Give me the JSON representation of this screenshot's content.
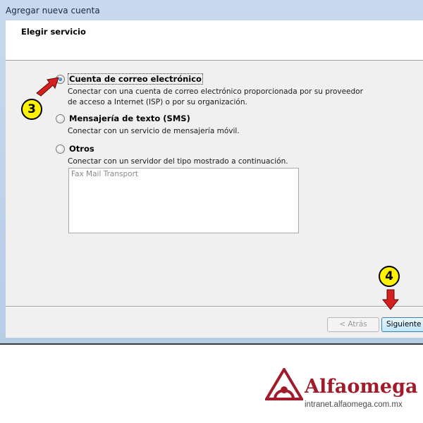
{
  "window": {
    "title": "Agregar nueva cuenta"
  },
  "header": {
    "title": "Elegir servicio"
  },
  "options": [
    {
      "label": "Cuenta de correo electrónico",
      "selected": true,
      "description": [
        "Conectar con una cuenta de correo electrónico proporcionada por su proveedor",
        "de acceso a Internet (ISP) o por su organización."
      ]
    },
    {
      "label": "Mensajería de texto (SMS)",
      "selected": false,
      "description": [
        "Conectar con un servicio de mensajería móvil."
      ]
    },
    {
      "label": "Otros",
      "selected": false,
      "description": [
        "Conectar con un servidor del tipo mostrado a continuación."
      ]
    }
  ],
  "server_list": {
    "items": [
      "Fax Mail Transport"
    ]
  },
  "buttons": {
    "back": "< Atrás",
    "next": "Siguiente >"
  },
  "callouts": [
    "3",
    "4"
  ],
  "brand": {
    "name": "Alfaomega",
    "url": "intranet.alfaomega.com.mx",
    "color": "#a01c2a"
  },
  "colors": {
    "callout_fill": "#fff200",
    "arrow": "#d61f1f"
  }
}
